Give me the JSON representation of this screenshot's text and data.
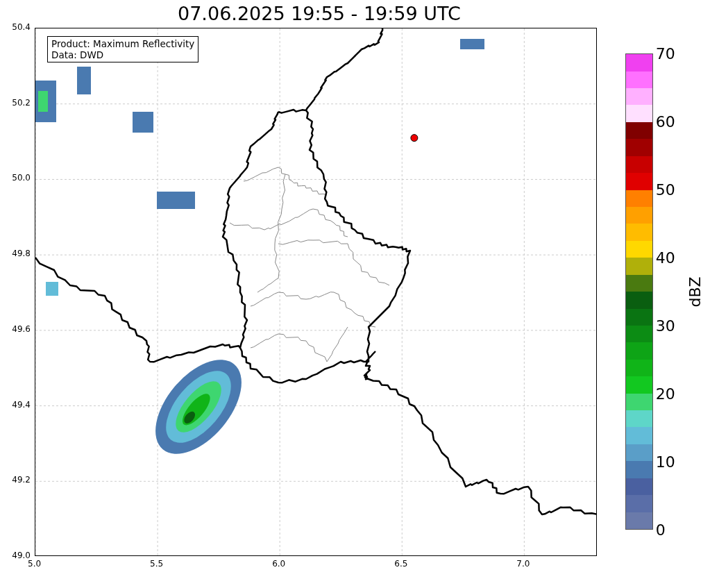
{
  "title": "07.06.2025 19:55 - 19:59 UTC",
  "map": {
    "legend": [
      "Product: Maximum Reflectivity",
      "Data: DWD"
    ],
    "xticks": [
      "5.0",
      "5.5",
      "6.0",
      "6.5",
      "7.0"
    ],
    "yticks": [
      "50.4",
      "50.2",
      "50.0",
      "49.8",
      "49.6",
      "49.4",
      "49.2",
      "49.0"
    ]
  },
  "colorbar": {
    "label": "dBZ",
    "ticks": [
      "70",
      "60",
      "50",
      "40",
      "30",
      "20",
      "10",
      "0"
    ],
    "segments": [
      {
        "color": "#6a7aaa"
      },
      {
        "color": "#5a6ea8"
      },
      {
        "color": "#4a60a0"
      },
      {
        "color": "#4a7ab0"
      },
      {
        "color": "#5a9ec8"
      },
      {
        "color": "#62bcd8"
      },
      {
        "color": "#5ed6c8"
      },
      {
        "color": "#3ed670"
      },
      {
        "color": "#12c820"
      },
      {
        "color": "#10b418"
      },
      {
        "color": "#0ea416"
      },
      {
        "color": "#0c8c14"
      },
      {
        "color": "#0a7412"
      },
      {
        "color": "#0a5e10"
      },
      {
        "color": "#4a7a10"
      },
      {
        "color": "#b0b00a"
      },
      {
        "color": "#ffd800"
      },
      {
        "color": "#ffbc00"
      },
      {
        "color": "#ffa000"
      },
      {
        "color": "#ff8000"
      },
      {
        "color": "#e00000"
      },
      {
        "color": "#c80000"
      },
      {
        "color": "#a00000"
      },
      {
        "color": "#800000"
      },
      {
        "color": "#ffe0ff"
      },
      {
        "color": "#ffb0ff"
      },
      {
        "color": "#ff70ff"
      },
      {
        "color": "#f040f0"
      }
    ]
  }
}
